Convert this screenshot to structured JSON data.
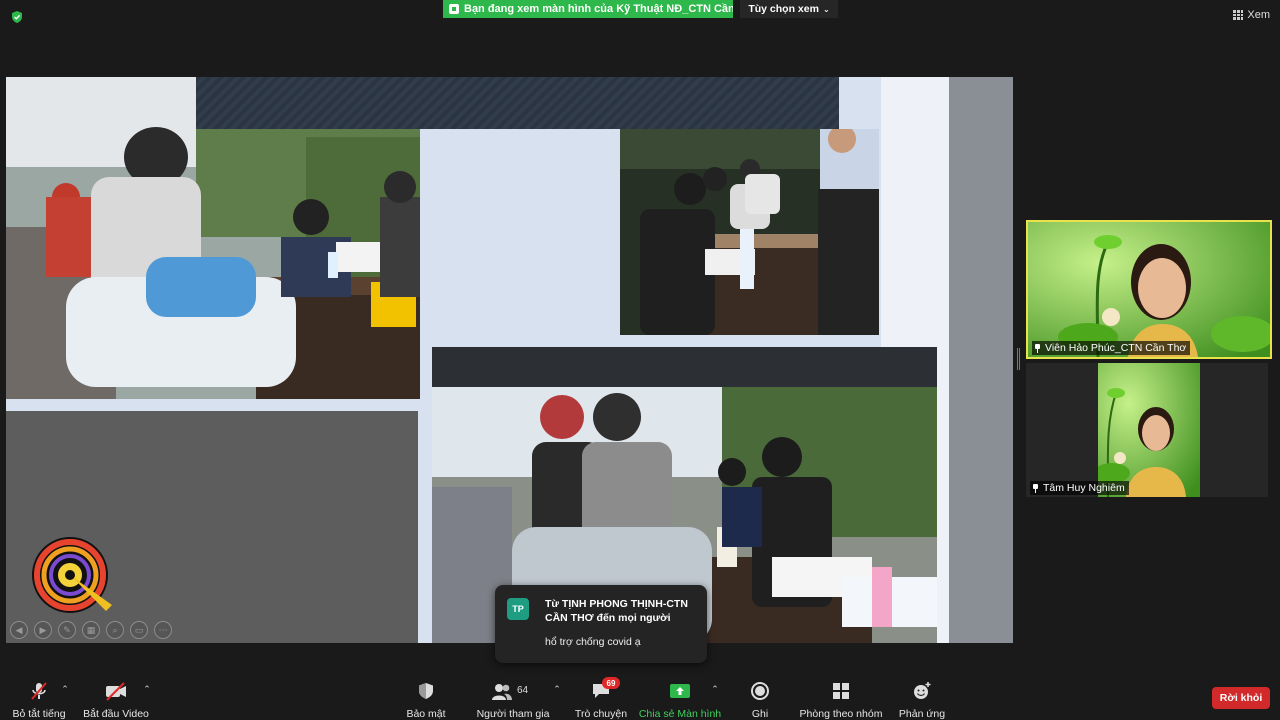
{
  "top_bar": {
    "share_banner": "Bạn đang xem màn hình của Kỹ Thuật NĐ_CTN Cần Thơ",
    "view_options": "Tùy chọn xem",
    "view_label": "Xem"
  },
  "participants": [
    {
      "name": "Viên Hảo Phúc_CTN Cần Thơ",
      "active_speaker": true
    },
    {
      "name": "Tâm Huy Nghiêm",
      "active_speaker": false
    }
  ],
  "chat": {
    "avatar_initials": "TP",
    "from": "Từ TỊNH PHONG THỊNH-CTN CẦN THƠ đến mọi người",
    "message": "hổ trợ chống covid ạ"
  },
  "toolbar": {
    "mute": "Bỏ tắt tiếng",
    "video": "Bắt đầu Video",
    "security": "Bảo mật",
    "participants": "Người tham gia",
    "participants_count": "64",
    "chat": "Trò chuyện",
    "chat_badge": "69",
    "share_screen": "Chia sẻ Màn hình",
    "record": "Ghi",
    "breakout_rooms": "Phòng theo nhóm",
    "reactions": "Phản ứng",
    "leave": "Rời khỏi"
  },
  "colors": {
    "background": "#1a1a1a",
    "share_green": "#2eb84b",
    "speaker_border": "#e8e34c",
    "leave_red": "#d22a2a",
    "chat_badge_red": "#e02828",
    "chat_avatar": "#1e9d83"
  },
  "icons": [
    "shield-icon",
    "grid-icon",
    "chevron-down-icon",
    "pin-icon",
    "microphone-muted-icon",
    "video-off-icon",
    "security-shield-icon",
    "participants-icon",
    "chat-bubble-icon",
    "share-screen-arrow-icon",
    "record-icon",
    "breakout-rooms-icon",
    "reaction-smile-icon"
  ]
}
